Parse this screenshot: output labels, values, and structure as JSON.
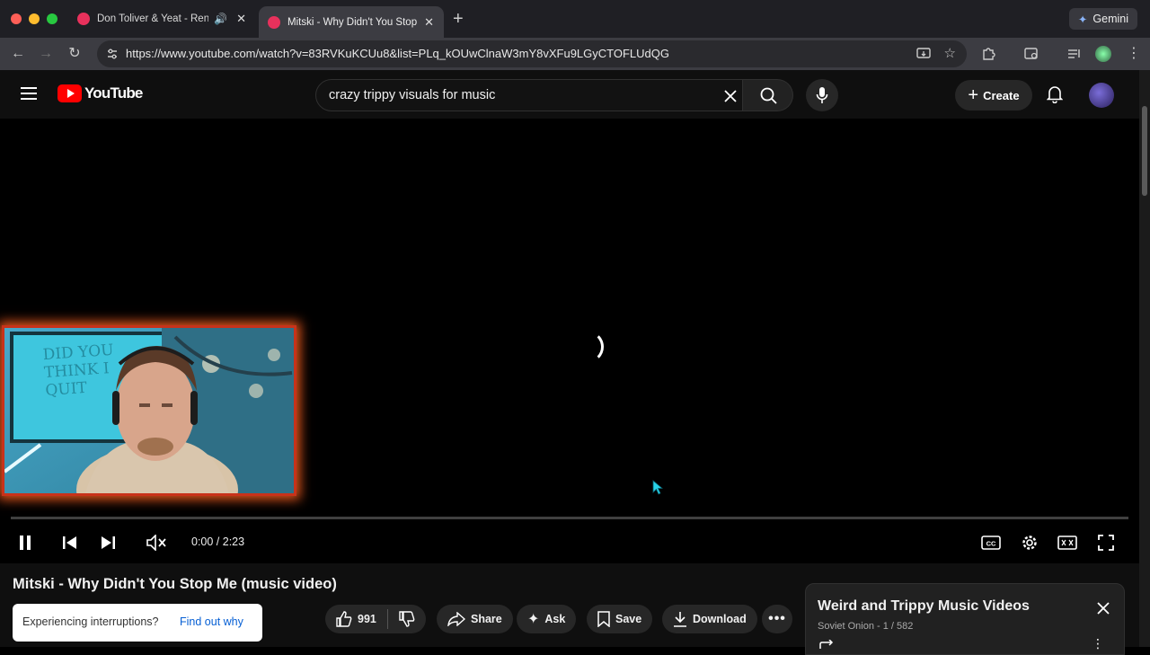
{
  "browser": {
    "tabs": [
      {
        "title": "Don Toliver & Yeat - Rende",
        "favicon_color": "#e8315c",
        "audio": true
      },
      {
        "title": "Mitski - Why Didn't You Stop",
        "favicon_color": "#e8315c",
        "active": true
      }
    ],
    "new_tab": "+",
    "gemini_label": "Gemini",
    "url": "https://www.youtube.com/watch?v=83RVKuKCUu8&list=PLq_kOUwClnaW3mY8vXFu9LGyCTOFLUdQG"
  },
  "youtube": {
    "logo_text": "YouTube",
    "search_query": "crazy trippy visuals for music",
    "create_label": "Create"
  },
  "player": {
    "time": "0:00 / 2:23",
    "progress": 0
  },
  "video": {
    "title": "Mitski - Why Didn't You Stop Me (music video)",
    "likes": "991",
    "share_label": "Share",
    "ask_label": "Ask",
    "save_label": "Save",
    "download_label": "Download"
  },
  "notice": {
    "text": "Experiencing interruptions?",
    "link": "Find out why"
  },
  "playlist": {
    "title": "Weird and Trippy Music Videos",
    "subtitle": "Soviet Onion - 1 / 582"
  },
  "webcam_overlay": {
    "whiteboard_text": "DID YOU THINK I QUIT"
  },
  "colors": {
    "youtube_red": "#ff0000",
    "link_blue": "#065fd4",
    "webcam_frame": "#e2551c"
  }
}
